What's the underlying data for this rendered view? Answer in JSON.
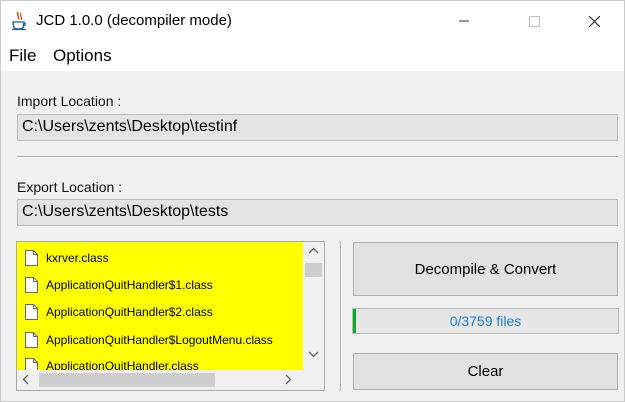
{
  "window": {
    "title": "JCD 1.0.0 (decompiler mode)",
    "icon": "java-cup-icon",
    "controls": {
      "minimize": "minimize-icon",
      "maximize": "maximize-icon",
      "close": "close-icon"
    }
  },
  "menu": {
    "file": "File",
    "options": "Options"
  },
  "import": {
    "label": "Import Location :",
    "value": "C:\\Users\\zents\\Desktop\\testinf"
  },
  "export": {
    "label": "Export Location :",
    "value": "C:\\Users\\zents\\Desktop\\tests"
  },
  "file_list": {
    "highlight_color": "#ffff00",
    "items": [
      "kxrver.class",
      "ApplicationQuitHandler$1.class",
      "ApplicationQuitHandler$2.class",
      "ApplicationQuitHandler$LogoutMenu.class",
      "ApplicationQuitHandler.class"
    ]
  },
  "actions": {
    "decompile": "Decompile & Convert",
    "clear": "Clear"
  },
  "progress": {
    "text": "0/3759 files",
    "fraction": 0,
    "fill_color": "#06b025",
    "text_color": "#1a7bd1"
  }
}
